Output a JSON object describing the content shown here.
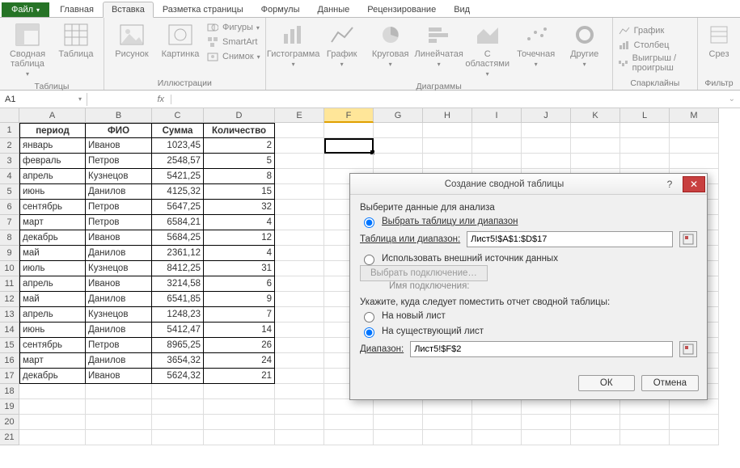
{
  "tabs": {
    "file": "Файл",
    "items": [
      "Главная",
      "Вставка",
      "Разметка страницы",
      "Формулы",
      "Данные",
      "Рецензирование",
      "Вид"
    ],
    "active": 1
  },
  "ribbon": {
    "tables": {
      "pivot": "Сводная\nтаблица",
      "table": "Таблица",
      "group": "Таблицы"
    },
    "illus": {
      "picture": "Рисунок",
      "clipart": "Картинка",
      "shapes": "Фигуры",
      "smartart": "SmartArt",
      "screenshot": "Снимок",
      "group": "Иллюстрации"
    },
    "charts": {
      "column": "Гистограмма",
      "line": "График",
      "pie": "Круговая",
      "bar": "Линейчатая",
      "area": "С\nобластями",
      "scatter": "Точечная",
      "other": "Другие",
      "group": "Диаграммы"
    },
    "spark": {
      "line": "График",
      "column": "Столбец",
      "winloss": "Выигрыш / проигрыш",
      "group": "Спарклайны"
    },
    "filter": {
      "slicer": "Срез",
      "group": "Фильтр"
    }
  },
  "formula_bar": {
    "name": "A1",
    "fx": "fx",
    "value": ""
  },
  "columns": [
    "A",
    "B",
    "C",
    "D",
    "E",
    "F",
    "G",
    "H",
    "I",
    "J",
    "K",
    "L",
    "M"
  ],
  "col_widths": {
    "A": 82,
    "B": 82,
    "C": 64,
    "D": 88
  },
  "headers": [
    "период",
    "ФИО",
    "Сумма",
    "Количество"
  ],
  "rows": [
    [
      "январь",
      "Иванов",
      "1023,45",
      "2"
    ],
    [
      "февраль",
      "Петров",
      "2548,57",
      "5"
    ],
    [
      "апрель",
      "Кузнецов",
      "5421,25",
      "8"
    ],
    [
      "июнь",
      "Данилов",
      "4125,32",
      "15"
    ],
    [
      "сентябрь",
      "Петров",
      "5647,25",
      "32"
    ],
    [
      "март",
      "Петров",
      "6584,21",
      "4"
    ],
    [
      "декабрь",
      "Иванов",
      "5684,25",
      "12"
    ],
    [
      "май",
      "Данилов",
      "2361,12",
      "4"
    ],
    [
      "июль",
      "Кузнецов",
      "8412,25",
      "31"
    ],
    [
      "апрель",
      "Иванов",
      "3214,58",
      "6"
    ],
    [
      "май",
      "Данилов",
      "6541,85",
      "9"
    ],
    [
      "апрель",
      "Кузнецов",
      "1248,23",
      "7"
    ],
    [
      "июнь",
      "Данилов",
      "5412,47",
      "14"
    ],
    [
      "сентябрь",
      "Петров",
      "8965,25",
      "26"
    ],
    [
      "март",
      "Данилов",
      "3654,32",
      "24"
    ],
    [
      "декабрь",
      "Иванов",
      "5624,32",
      "21"
    ]
  ],
  "dialog": {
    "title": "Создание сводной таблицы",
    "select_data": "Выберите данные для анализа",
    "opt_range": "Выбрать таблицу или диапазон",
    "range_label": "Таблица или диапазон:",
    "range_value": "Лист5!$A$1:$D$17",
    "opt_external": "Использовать внешний источник данных",
    "choose_conn": "Выбрать подключение…",
    "conn_name": "Имя подключения:",
    "place_label": "Укажите, куда следует поместить отчет сводной таблицы:",
    "opt_new": "На новый лист",
    "opt_exist": "На существующий лист",
    "dest_label": "Диапазон:",
    "dest_value": "Лист5!$F$2",
    "ok": "ОК",
    "cancel": "Отмена"
  }
}
